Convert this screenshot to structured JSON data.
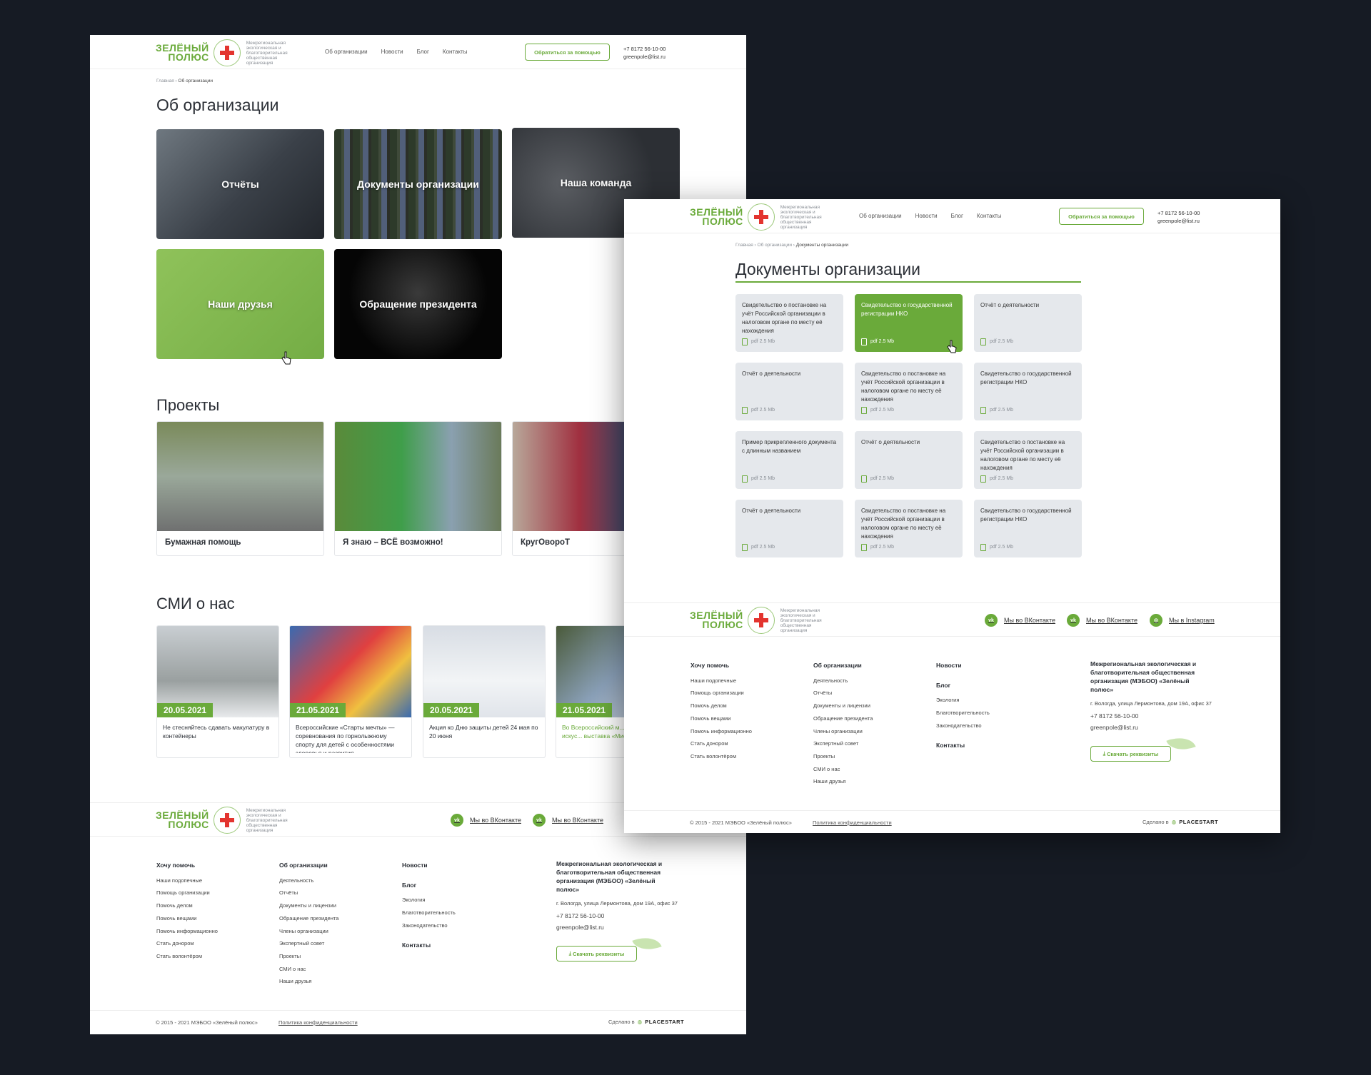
{
  "header": {
    "logo_line1": "ЗЕЛЁНЫЙ",
    "logo_line2": "ПОЛЮС",
    "logo_sub": "Межрегиональная экологическая и благотворительная общественная организация",
    "nav": [
      "Об организации",
      "Новости",
      "Блог",
      "Контакты"
    ],
    "help_button": "Обратиться за помощью",
    "phone": "+7 8172 56-10-00",
    "email": "greenpole@list.ru"
  },
  "about_page": {
    "breadcrumb_home": "Главная",
    "breadcrumb_current": "Об организации",
    "title": "Об организации",
    "tiles": [
      "Отчёты",
      "Документы организации",
      "Наша команда",
      "Наши друзья",
      "Обращение президента"
    ],
    "projects_title": "Проекты",
    "projects": [
      "Бумажная помощь",
      "Я знаю – ВСЁ возможно!",
      "КругОвороТ"
    ],
    "media_title": "СМИ о нас",
    "news": [
      {
        "date": "20.05.2021",
        "text": "Не стесняйтесь сдавать макулатуру в контейнеры"
      },
      {
        "date": "21.05.2021",
        "text": "Всероссийские «Старты мечты» — соревнования по горнолыжному спорту для детей с особенностями здоровья и развития"
      },
      {
        "date": "20.05.2021",
        "text": "Акция ко Дню защиты детей 24 мая по 20 июня"
      },
      {
        "date": "21.05.2021",
        "text": "Во Всероссийский м... декоративного искус... выставка «Миссия М..."
      }
    ]
  },
  "docs_page": {
    "breadcrumb_home": "Главная",
    "breadcrumb_mid": "Об организации",
    "breadcrumb_current": "Документы организации",
    "title": "Документы организации",
    "file_meta": "pdf 2.5 Mb",
    "documents": [
      "Свидетельство о постановке на учёт Российской организации в налоговом органе по месту её нахождения",
      "Свидетельство о государственной регистрации НКО",
      "Отчёт о деятельности",
      "Отчёт о деятельности",
      "Свидетельство о постановке на учёт Российской организации в налоговом органе по месту её нахождения",
      "Свидетельство о государственной регистрации НКО",
      "Пример прикрепленного документа с длинным названием",
      "Отчёт о деятельности",
      "Свидетельство о постановке на учёт Российской организации в налоговом органе по месту её нахождения",
      "Отчёт о деятельности",
      "Свидетельство о постановке на учёт Российской организации в налоговом органе по месту её нахождения",
      "Свидетельство о государственной регистрации НКО"
    ]
  },
  "footer": {
    "social": [
      "Мы во ВКонтакте",
      "Мы во ВКонтакте",
      "Мы в Instagram"
    ],
    "help_title": "Хочу помочь",
    "help_items": [
      "Наши подопечные",
      "Помощь организации",
      "Помочь делом",
      "Помочь вещами",
      "Помочь информационно",
      "Стать донором",
      "Стать волонтёром"
    ],
    "about_title": "Об организации",
    "about_items": [
      "Деятельность",
      "Отчёты",
      "Документы и лицензии",
      "Обращение президента",
      "Члены организации",
      "Экспертный совет",
      "Проекты",
      "СМИ о нас",
      "Наши друзья"
    ],
    "news_title": "Новости",
    "blog_title": "Блог",
    "blog_items": [
      "Экология",
      "Благотворительность",
      "Законодательство"
    ],
    "contacts_title": "Контакты",
    "org_name": "Межрегиональная экологическая и благотворительная общественная организация (МЭБОО) «Зелёный полюс»",
    "address": "г. Вологда, улица Лермонтова, дом 19А, офис 37",
    "phone": "+7 8172 56-10-00",
    "email": "greenpole@list.ru",
    "requisites_button": "Скачать реквизиты",
    "copyright": "© 2015 - 2021 МЭБОО «Зелёный полюс»",
    "privacy": "Политика конфиденциальности",
    "made_by_prefix": "Сделано в",
    "made_by": "PLACESTART"
  },
  "colors": {
    "accent": "#6aaa3a",
    "background": "#161b24"
  }
}
